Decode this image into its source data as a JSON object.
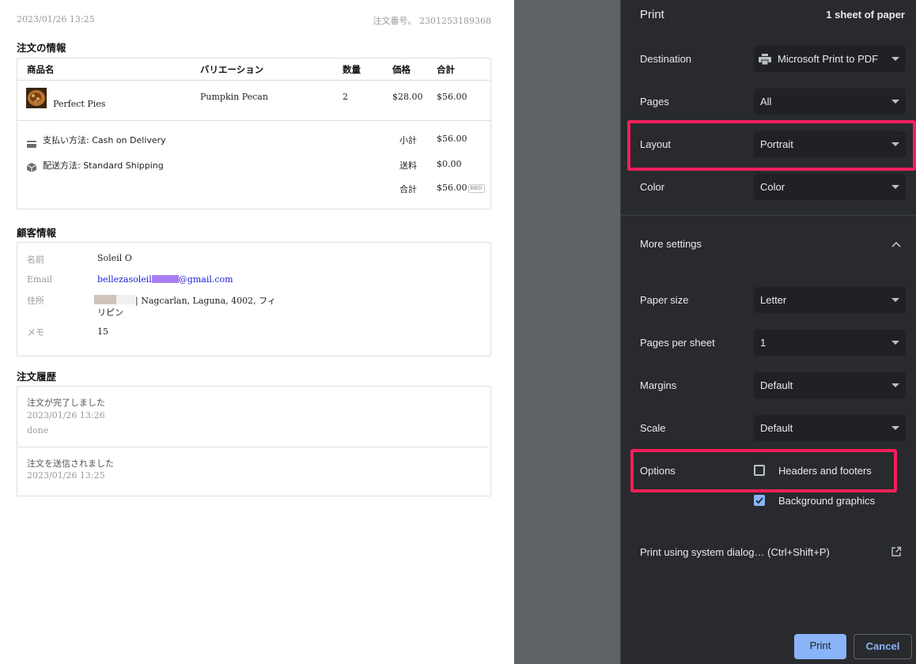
{
  "preview": {
    "timestamp": "2023/01/26 13:25",
    "order_number": "注文番号。 2301253189368",
    "order_info": {
      "heading": "注文の情報",
      "columns": [
        "商品名",
        "バリエーション",
        "数量",
        "価格",
        "合計"
      ],
      "item": {
        "name": "Perfect Pies",
        "variation": "Pumpkin Pecan",
        "quantity": "2",
        "price": "$28.00",
        "total": "$56.00"
      },
      "payment": "支払い方法: Cash on Delivery",
      "shipping": "配送方法: Standard Shipping",
      "subtotal_label": "小計",
      "subtotal_value": "$56.00",
      "shipping_label": "送料",
      "shipping_value": "$0.00",
      "total_label": "合計",
      "total_value": "$56.00",
      "currency": "BBD"
    },
    "customer": {
      "heading": "顧客情報",
      "name_label": "名前",
      "name_value": "Soleil O",
      "email_label": "Email",
      "email_prefix": "bellezasoleil",
      "email_suffix": "@gmail.com",
      "address_label": "住所",
      "address_line1": "| Nagcarlan, Laguna, 4002, フィ",
      "address_line2": "リピン",
      "memo_label": "メモ",
      "memo_value": "15"
    },
    "history": {
      "heading": "注文履歴",
      "entries": [
        {
          "title": "注文が完了しました",
          "time": "2023/01/26 13:26",
          "note": "done"
        },
        {
          "title": "注文を送信されました",
          "time": "2023/01/26 13:25"
        }
      ]
    }
  },
  "panel": {
    "title": "Print",
    "sheets": "1 sheet of paper",
    "destination": {
      "label": "Destination",
      "value": "Microsoft Print to PDF",
      "icon": "printer-icon"
    },
    "pages": {
      "label": "Pages",
      "value": "All"
    },
    "layout": {
      "label": "Layout",
      "value": "Portrait"
    },
    "color": {
      "label": "Color",
      "value": "Color"
    },
    "more_settings": "More settings",
    "paper_size": {
      "label": "Paper size",
      "value": "Letter"
    },
    "pages_per_sheet": {
      "label": "Pages per sheet",
      "value": "1"
    },
    "margins": {
      "label": "Margins",
      "value": "Default"
    },
    "scale": {
      "label": "Scale",
      "value": "Default"
    },
    "options": {
      "label": "Options",
      "headers_footers": "Headers and footers",
      "headers_footers_checked": false,
      "background_graphics": "Background graphics",
      "background_graphics_checked": true
    },
    "system_dialog": "Print using system dialog… (Ctrl+Shift+P)",
    "print_button": "Print",
    "cancel_button": "Cancel",
    "colors": {
      "highlight": "#f21f5b",
      "accent": "#8ab4f8",
      "panel_bg": "#292a2d",
      "field_bg": "#202124"
    }
  }
}
